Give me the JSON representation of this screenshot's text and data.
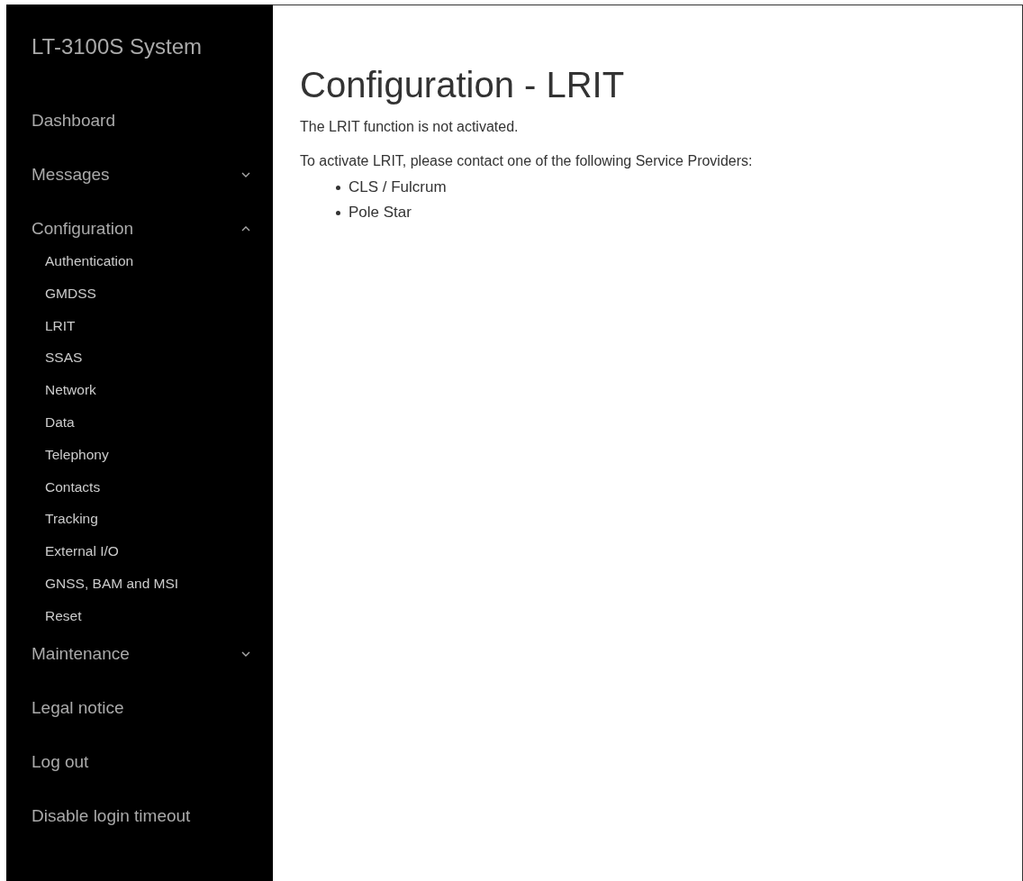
{
  "sidebar": {
    "title": "LT-3100S System",
    "items": [
      {
        "label": "Dashboard"
      },
      {
        "label": "Messages",
        "expanded": false
      },
      {
        "label": "Configuration",
        "expanded": true,
        "children": [
          {
            "label": "Authentication"
          },
          {
            "label": "GMDSS"
          },
          {
            "label": "LRIT"
          },
          {
            "label": "SSAS"
          },
          {
            "label": "Network"
          },
          {
            "label": "Data"
          },
          {
            "label": "Telephony"
          },
          {
            "label": "Contacts"
          },
          {
            "label": "Tracking"
          },
          {
            "label": "External I/O"
          },
          {
            "label": "GNSS, BAM and MSI"
          },
          {
            "label": "Reset"
          }
        ]
      },
      {
        "label": "Maintenance",
        "expanded": false
      },
      {
        "label": "Legal notice"
      },
      {
        "label": "Log out"
      },
      {
        "label": "Disable login timeout"
      }
    ]
  },
  "main": {
    "heading": "Configuration - LRIT",
    "paragraphs": [
      "The LRIT function is not activated.",
      "To activate LRIT, please contact one of the following Service Providers:"
    ],
    "providers": [
      "CLS / Fulcrum",
      "Pole Star"
    ]
  }
}
